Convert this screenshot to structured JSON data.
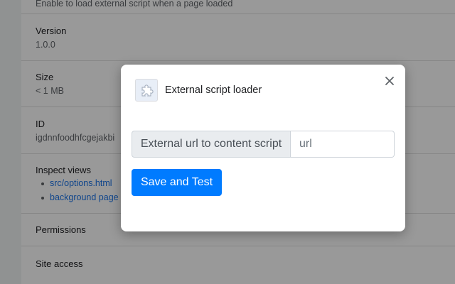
{
  "background": {
    "top_description": "Enable to load external script when a page loaded",
    "version": {
      "title": "Version",
      "value": "1.0.0"
    },
    "size": {
      "title": "Size",
      "value": "< 1 MB"
    },
    "id": {
      "title": "ID",
      "value": "igdnnfoodhfcgejakbi"
    },
    "inspect_views": {
      "title": "Inspect views",
      "links": [
        "src/options.html",
        "background page"
      ]
    },
    "permissions": {
      "title": "Permissions"
    },
    "site_access": {
      "title": "Site access"
    }
  },
  "dialog": {
    "icon": "puzzle-piece-icon",
    "title": "External script loader",
    "close_icon": "close-icon",
    "input_label": "External url to content script",
    "input_placeholder": "url",
    "input_value": "",
    "save_button": "Save and Test"
  },
  "colors": {
    "primary": "#007bff",
    "link": "#1a73e8",
    "overlay": "rgba(0,0,0,0.40)"
  }
}
